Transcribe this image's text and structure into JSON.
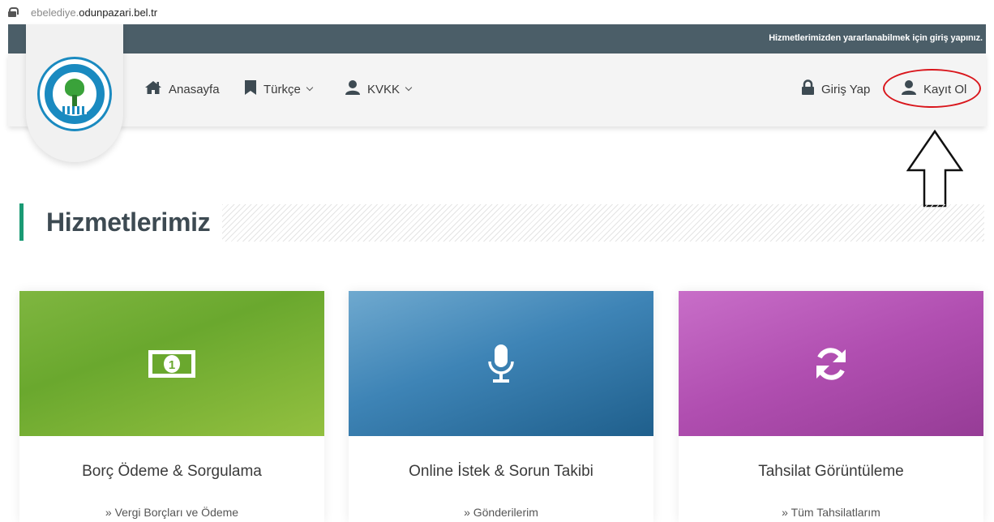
{
  "browser": {
    "url_subdomain": "ebelediye.",
    "url_domain": "odunpazari.bel.tr"
  },
  "top_strip": {
    "message": "Hizmetlerimizden yararlanabilmek için giriş yapınız."
  },
  "nav": {
    "home": "Anasayfa",
    "language": "Türkçe",
    "kvkk": "KVKK",
    "login": "Giriş Yap",
    "register": "Kayıt Ol"
  },
  "section": {
    "title": "Hizmetlerimiz"
  },
  "cards": [
    {
      "title": "Borç Ödeme & Sorgulama",
      "link": "» Vergi Borçları ve Ödeme",
      "icon": "money-bill-icon"
    },
    {
      "title": "Online İstek & Sorun Takibi",
      "link": "» Gönderilerim",
      "icon": "microphone-icon"
    },
    {
      "title": "Tahsilat Görüntüleme",
      "link": "» Tüm Tahsilatlarım",
      "icon": "refresh-icon"
    }
  ],
  "colors": {
    "top_strip": "#4b5e68",
    "accent_green": "#1a9a74",
    "annotation_red": "#d9161c",
    "card1_overlay": "#7fb640",
    "card2_overlay": "#3e84b6",
    "card3_overlay": "#b04eb0"
  }
}
